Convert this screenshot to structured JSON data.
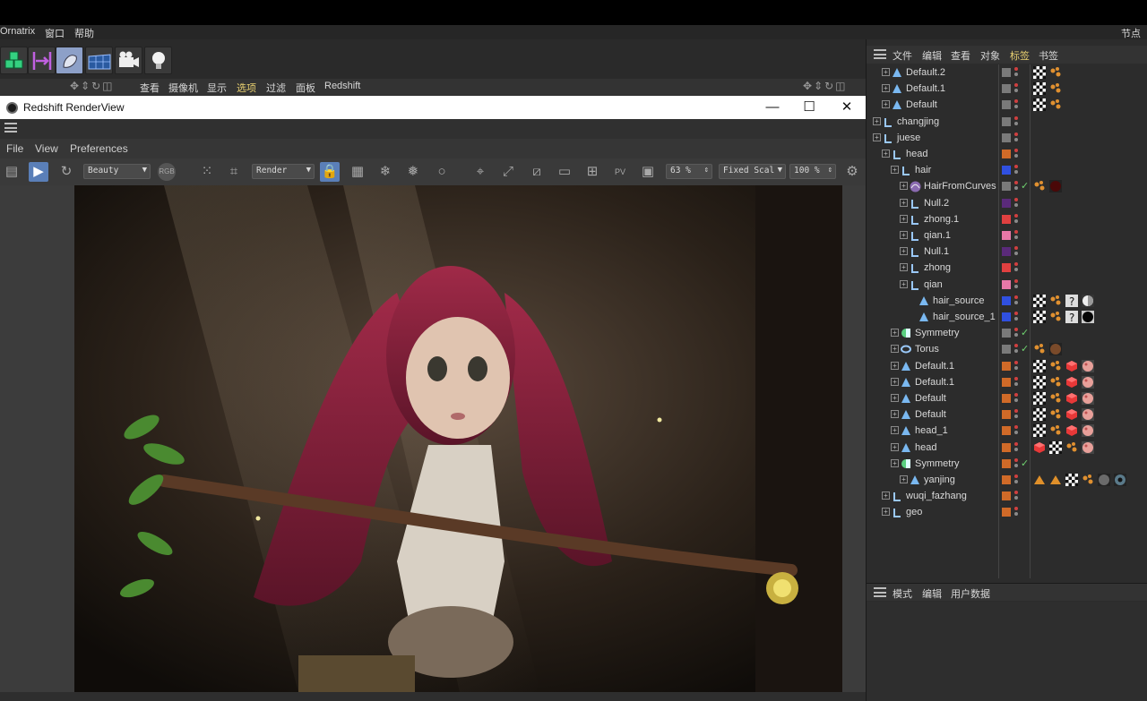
{
  "menubar": {
    "items": [
      "Ornatrix",
      "窗口",
      "帮助"
    ],
    "right_label": "节点空"
  },
  "viewport_menu": {
    "items": [
      "查看",
      "摄像机",
      "显示",
      "选项",
      "过滤",
      "面板",
      "Redshift"
    ],
    "selected": "选项"
  },
  "renderview": {
    "title": "Redshift RenderView",
    "menus": [
      "File",
      "View",
      "Preferences"
    ],
    "aov": "Beauty",
    "rgb": "RGB",
    "render_mode": "Render",
    "zoom": "63 %",
    "fit_mode": "Fixed Scal",
    "scale": "100 %",
    "pv_label": "PV",
    "min_glyph": "—",
    "max_glyph": "☐",
    "close_glyph": "✕"
  },
  "object_manager": {
    "menus": [
      "文件",
      "编辑",
      "查看",
      "对象",
      "标签",
      "书签"
    ],
    "selected_menu": "标签",
    "rows": [
      {
        "name": "Default.2",
        "depth": 1,
        "icon": "light-icon",
        "color": "#7a7a7a",
        "tags": [
          "checker-tag",
          "dots-tag"
        ]
      },
      {
        "name": "Default.1",
        "depth": 1,
        "icon": "light-icon",
        "color": "#7a7a7a",
        "tags": [
          "checker-tag",
          "dots-tag"
        ]
      },
      {
        "name": "Default",
        "depth": 1,
        "icon": "light-icon",
        "color": "#7a7a7a",
        "tags": [
          "checker-tag",
          "dots-tag"
        ]
      },
      {
        "name": "changjing",
        "depth": 0,
        "icon": "null-icon",
        "color": "#7a7a7a",
        "tags": []
      },
      {
        "name": "juese",
        "depth": 0,
        "icon": "null-icon",
        "color": "#7a7a7a",
        "tags": []
      },
      {
        "name": "head",
        "depth": 1,
        "icon": "null-icon",
        "color": "#d06a28",
        "tags": []
      },
      {
        "name": "hair",
        "depth": 2,
        "icon": "null-icon",
        "color": "#3050e0",
        "tags": []
      },
      {
        "name": "HairFromCurves",
        "depth": 3,
        "icon": "hair-icon",
        "color": "#7a7a7a",
        "check": true,
        "tags": [
          "dots-tag",
          "material-dark-red-tag"
        ]
      },
      {
        "name": "Null.2",
        "depth": 3,
        "icon": "null-icon",
        "color": "#5a2a7a",
        "tags": []
      },
      {
        "name": "zhong.1",
        "depth": 3,
        "icon": "null-icon",
        "color": "#e04040",
        "tags": []
      },
      {
        "name": "qian.1",
        "depth": 3,
        "icon": "null-icon",
        "color": "#e878a8",
        "tags": []
      },
      {
        "name": "Null.1",
        "depth": 3,
        "icon": "null-icon",
        "color": "#5a2a7a",
        "tags": []
      },
      {
        "name": "zhong",
        "depth": 3,
        "icon": "null-icon",
        "color": "#e04040",
        "tags": []
      },
      {
        "name": "qian",
        "depth": 3,
        "icon": "null-icon",
        "color": "#e878a8",
        "tags": []
      },
      {
        "name": "hair_source",
        "depth": 4,
        "icon": "poly-icon",
        "color": "#3050e0",
        "tags": [
          "checker-tag",
          "dots-tag",
          "question-tag",
          "material-white-tag"
        ]
      },
      {
        "name": "hair_source_1",
        "depth": 4,
        "icon": "poly-icon",
        "color": "#3050e0",
        "tags": [
          "checker-tag",
          "dots-tag",
          "question-tag",
          "material-black-tag"
        ]
      },
      {
        "name": "Symmetry",
        "depth": 2,
        "icon": "symmetry-icon",
        "color": "#7a7a7a",
        "check": true,
        "tags": []
      },
      {
        "name": "Torus",
        "depth": 2,
        "icon": "torus-icon",
        "color": "#7a7a7a",
        "check": true,
        "tags": [
          "dots-tag",
          "material-brown-tag"
        ]
      },
      {
        "name": "Default.1",
        "depth": 2,
        "icon": "poly-icon",
        "color": "#d06a28",
        "tags": [
          "checker-tag",
          "dots-tag",
          "red-cube-tag",
          "skin-tag"
        ]
      },
      {
        "name": "Default.1",
        "depth": 2,
        "icon": "poly-icon",
        "color": "#d06a28",
        "tags": [
          "checker-tag",
          "dots-tag",
          "red-cube-tag",
          "skin-tag"
        ]
      },
      {
        "name": "Default",
        "depth": 2,
        "icon": "poly-icon",
        "color": "#d06a28",
        "tags": [
          "checker-tag",
          "dots-tag",
          "red-cube-tag",
          "skin-tag"
        ]
      },
      {
        "name": "Default",
        "depth": 2,
        "icon": "poly-icon",
        "color": "#d06a28",
        "tags": [
          "checker-tag",
          "dots-tag",
          "red-cube-tag",
          "skin-tag"
        ]
      },
      {
        "name": "head_1",
        "depth": 2,
        "icon": "poly-icon",
        "color": "#d06a28",
        "tags": [
          "checker-tag",
          "dots-tag",
          "red-cube-tag",
          "skin-tag"
        ]
      },
      {
        "name": "head",
        "depth": 2,
        "icon": "poly-icon",
        "color": "#d06a28",
        "tags": [
          "red-cube-tag",
          "checker-tag",
          "dots-tag",
          "skin-tag"
        ]
      },
      {
        "name": "Symmetry",
        "depth": 2,
        "icon": "symmetry-icon",
        "color": "#d06a28",
        "check": true,
        "tags": []
      },
      {
        "name": "yanjing",
        "depth": 3,
        "icon": "poly-icon",
        "color": "#d06a28",
        "tags": [
          "cone-tag",
          "cone-tag",
          "checker-tag",
          "dots-tag",
          "material-grey-tag",
          "material-eye-tag"
        ]
      },
      {
        "name": "wuqi_fazhang",
        "depth": 1,
        "icon": "null-icon",
        "color": "#d06a28",
        "tags": []
      },
      {
        "name": "geo",
        "depth": 1,
        "icon": "null-icon",
        "color": "#d06a28",
        "tags": []
      }
    ]
  },
  "attributes": {
    "menus": [
      "模式",
      "编辑",
      "用户数据"
    ]
  }
}
